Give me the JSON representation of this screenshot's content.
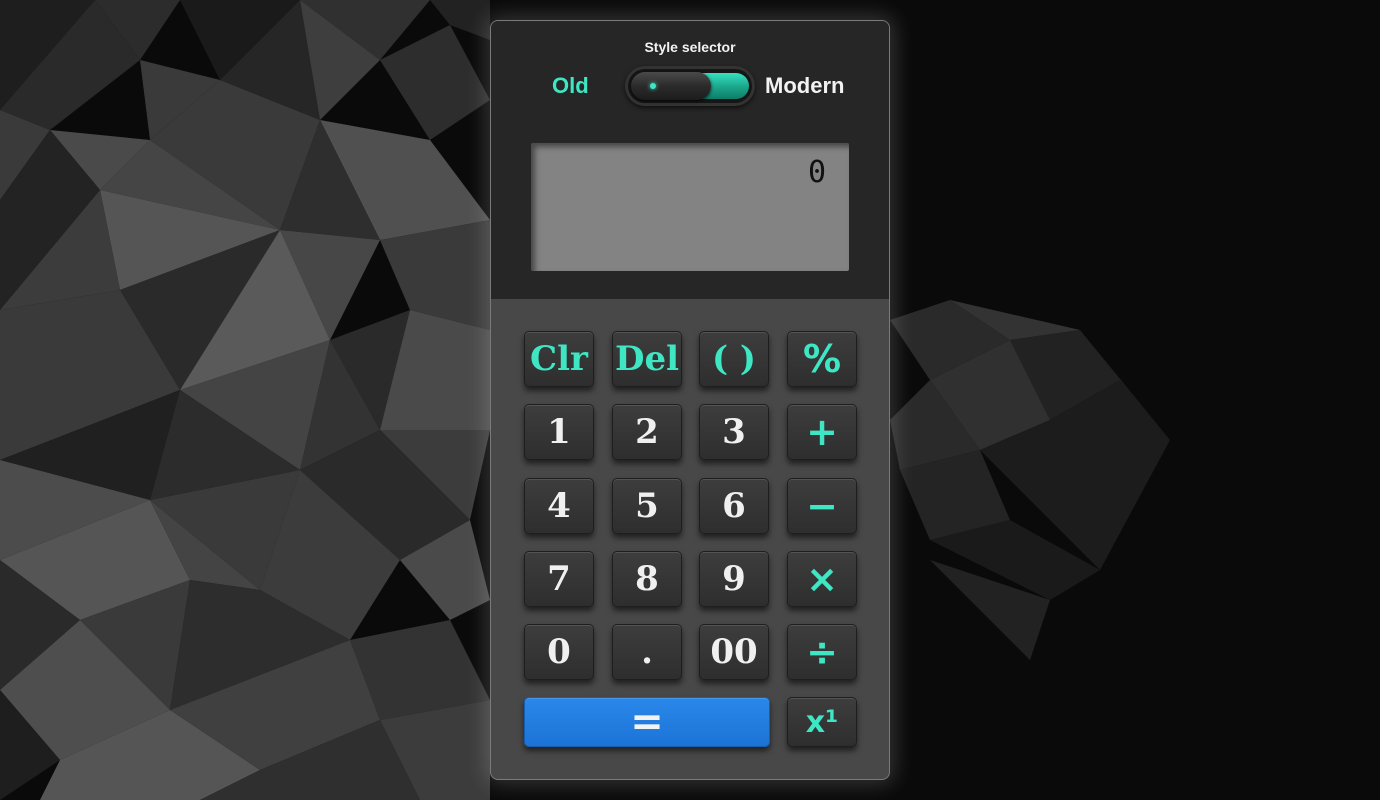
{
  "style_selector": {
    "title": "Style selector",
    "option_old": "Old",
    "option_modern": "Modern",
    "selected": "Modern"
  },
  "display": {
    "value": "0"
  },
  "keys": {
    "row1": [
      "Clr",
      "Del",
      "( )",
      "%"
    ],
    "row2": [
      "1",
      "2",
      "3",
      "+"
    ],
    "row3": [
      "4",
      "5",
      "6",
      "−"
    ],
    "row4": [
      "7",
      "8",
      "9",
      "×"
    ],
    "row5": [
      "0",
      ".",
      "00",
      "÷"
    ],
    "row6": [
      "=",
      "x¹"
    ]
  },
  "colors": {
    "accent": "#3ee6c4",
    "equals": "#1f7ae0",
    "background": "#0a0a0a",
    "body": "#484848",
    "display": "#838383"
  }
}
